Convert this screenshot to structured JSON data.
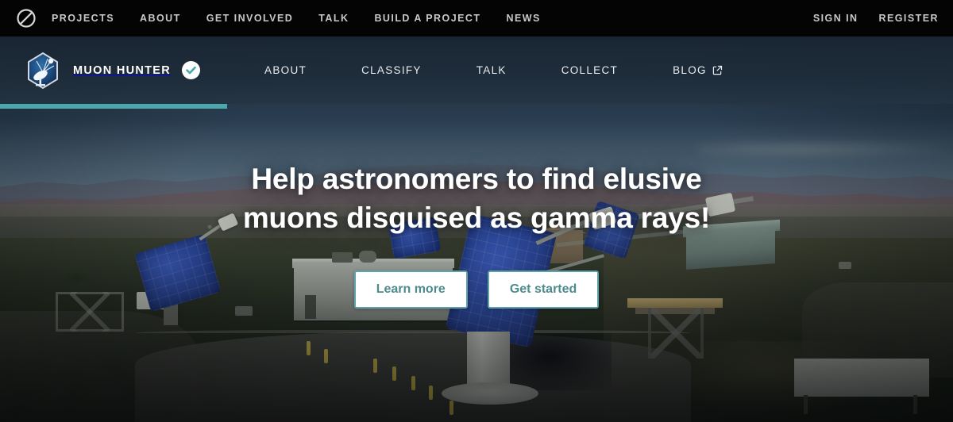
{
  "zooniverse_bar": {
    "logo_icon": "zooniverse-logo",
    "links": [
      {
        "label": "Projects"
      },
      {
        "label": "About"
      },
      {
        "label": "Get Involved"
      },
      {
        "label": "Talk"
      },
      {
        "label": "Build a Project"
      },
      {
        "label": "News"
      }
    ],
    "auth": [
      {
        "label": "Sign In"
      },
      {
        "label": "Register"
      }
    ]
  },
  "project_header": {
    "avatar_icon": "muon-hunter-telescope-badge",
    "title": "Muon Hunter",
    "verified_icon": "check-circle-icon",
    "verified": true,
    "nav": [
      {
        "label": "About",
        "external": false
      },
      {
        "label": "Classify",
        "external": false
      },
      {
        "label": "Talk",
        "external": false
      },
      {
        "label": "Collect",
        "external": false
      },
      {
        "label": "Blog",
        "external": true,
        "icon": "external-link-icon"
      }
    ],
    "accent_color": "#4aa8ad"
  },
  "hero": {
    "title_line1": "Help astronomers to find elusive",
    "title_line2": "muons disguised as gamma rays!",
    "buttons": [
      {
        "label": "Learn more"
      },
      {
        "label": "Get started"
      }
    ],
    "button_text_color": "#4d8b8e",
    "button_border_color": "#5fa3a6",
    "background_description": "VERITAS observatory telescope array in desert landscape at dusk"
  }
}
